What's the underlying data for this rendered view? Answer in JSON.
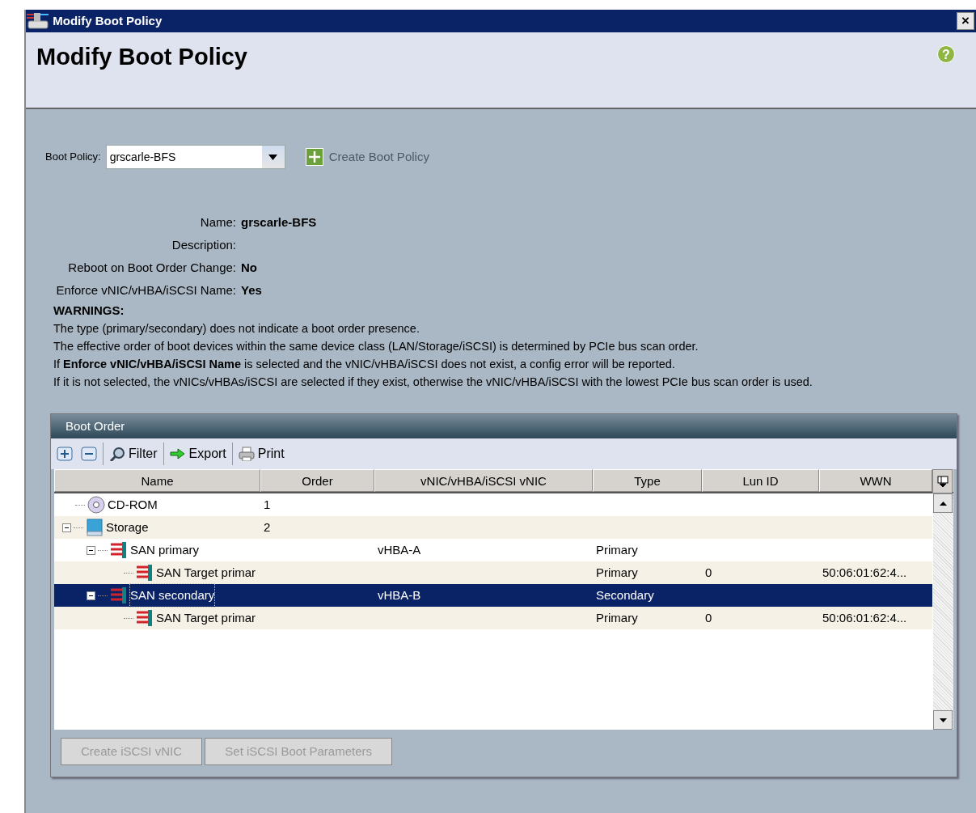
{
  "window": {
    "title": "Modify Boot Policy",
    "close": "×"
  },
  "header": {
    "title": "Modify Boot Policy",
    "help": "?"
  },
  "boot_policy": {
    "label": "Boot Policy:",
    "value": "grscarle-BFS",
    "create_link": "Create Boot Policy"
  },
  "details": [
    {
      "label": "Name:",
      "value": "grscarle-BFS"
    },
    {
      "label": "Description:"
    },
    {
      "label": "Reboot on Boot Order Change:",
      "value": "No"
    },
    {
      "label": "Enforce vNIC/vHBA/iSCSI Name:",
      "value": "Yes"
    }
  ],
  "warnings": {
    "title": "WARNINGS:",
    "lines": [
      "The type (primary/secondary) does not indicate a boot order presence.",
      "The effective order of boot devices within the same device class (LAN/Storage/iSCSI) is determined by PCIe bus scan order.",
      "If **Enforce vNIC/vHBA/iSCSI Name** is selected and the vNIC/vHBA/iSCSI does not exist, a config error will be reported.",
      "If it is not selected, the vNICs/vHBAs/iSCSI are selected if they exist, otherwise the vNIC/vHBA/iSCSI with the lowest PCIe bus scan order is used."
    ]
  },
  "boot_order": {
    "title": "Boot Order",
    "toolbar": [
      {
        "kind": "expand"
      },
      {
        "kind": "collapse"
      },
      {
        "kind": "filter",
        "label": "Filter"
      },
      {
        "kind": "export",
        "label": "Export"
      },
      {
        "kind": "print",
        "label": "Print"
      }
    ],
    "columns": [
      "Name",
      "Order",
      "vNIC/vHBA/iSCSI vNIC",
      "Type",
      "Lun ID",
      "WWN"
    ],
    "rows": [
      {
        "kind": "cdrom",
        "name": "CD-ROM",
        "order": "1",
        "selected": false
      },
      {
        "kind": "storage",
        "name": "Storage",
        "order": "2",
        "selected": false,
        "expanded": true,
        "children": [
          {
            "kind": "san",
            "name": "SAN primary",
            "vnic": "vHBA-A",
            "type": "Primary",
            "selected": false,
            "expanded": true,
            "children": [
              {
                "kind": "san",
                "name": "SAN Target primar",
                "type": "Primary",
                "lun_id": "0",
                "wwn": "50:06:01:62:4...",
                "selected": false
              }
            ]
          },
          {
            "kind": "san",
            "name": "SAN secondary",
            "vnic": "vHBA-B",
            "type": "Secondary",
            "selected": true,
            "expanded": true,
            "children": [
              {
                "kind": "san",
                "name": "SAN Target primar",
                "type": "Primary",
                "lun_id": "0",
                "wwn": "50:06:01:62:4...",
                "selected": false
              }
            ]
          }
        ]
      }
    ],
    "buttons": [
      {
        "label": "Create iSCSI vNIC",
        "disabled": true
      },
      {
        "label": "Set iSCSI Boot Parameters",
        "disabled": true
      }
    ]
  }
}
